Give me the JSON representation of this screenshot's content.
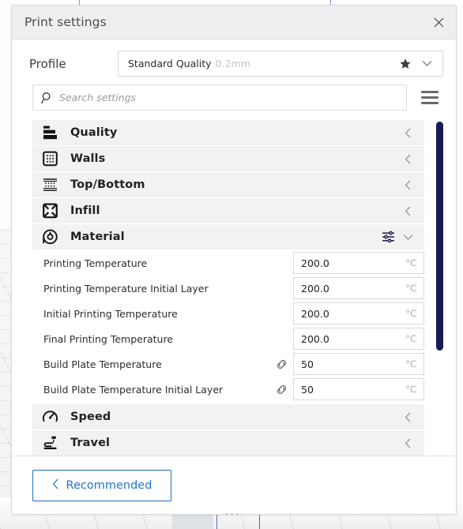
{
  "window": {
    "title": "Print settings",
    "close_icon": "close-icon"
  },
  "profile": {
    "label": "Profile",
    "name": "Standard Quality",
    "sub": "0.2mm",
    "star_icon": "star-icon",
    "caret_icon": "chevron-down-icon"
  },
  "search": {
    "placeholder": "Search settings",
    "value": "",
    "icon": "search-icon",
    "menu_icon": "hamburger-menu-icon"
  },
  "categories": [
    {
      "label": "Quality",
      "icon": "quality-icon",
      "expanded": false,
      "arrow": "chevron-left-icon"
    },
    {
      "label": "Walls",
      "icon": "walls-icon",
      "expanded": false,
      "arrow": "chevron-left-icon"
    },
    {
      "label": "Top/Bottom",
      "icon": "topbottom-icon",
      "expanded": false,
      "arrow": "chevron-left-icon"
    },
    {
      "label": "Infill",
      "icon": "infill-icon",
      "expanded": false,
      "arrow": "chevron-left-icon"
    },
    {
      "label": "Material",
      "icon": "material-icon",
      "expanded": true,
      "arrow": "chevron-down-icon",
      "settings_icon": "sliders-icon"
    },
    {
      "label": "Speed",
      "icon": "speed-icon",
      "expanded": false,
      "arrow": "chevron-left-icon"
    },
    {
      "label": "Travel",
      "icon": "travel-icon",
      "expanded": false,
      "arrow": "chevron-left-icon"
    }
  ],
  "material_settings": [
    {
      "label": "Printing Temperature",
      "value": "200.0",
      "unit": "°C",
      "linked": false
    },
    {
      "label": "Printing Temperature Initial Layer",
      "value": "200.0",
      "unit": "°C",
      "linked": false
    },
    {
      "label": "Initial Printing Temperature",
      "value": "200.0",
      "unit": "°C",
      "linked": false
    },
    {
      "label": "Final Printing Temperature",
      "value": "200.0",
      "unit": "°C",
      "linked": false
    },
    {
      "label": "Build Plate Temperature",
      "value": "50",
      "unit": "°C",
      "linked": true,
      "link_icon": "link-icon"
    },
    {
      "label": "Build Plate Temperature Initial Layer",
      "value": "50",
      "unit": "°C",
      "linked": true,
      "link_icon": "link-icon"
    }
  ],
  "footer": {
    "recommended_label": "Recommended",
    "back_arrow": "chevron-left-icon"
  },
  "colors": {
    "accent_blue": "#2176c7",
    "scrollbar": "#181a55",
    "category_row_bg": "#f2f2f3",
    "titlebar_bg": "#eeeff0",
    "settings_icon": "#1c1b4a"
  }
}
